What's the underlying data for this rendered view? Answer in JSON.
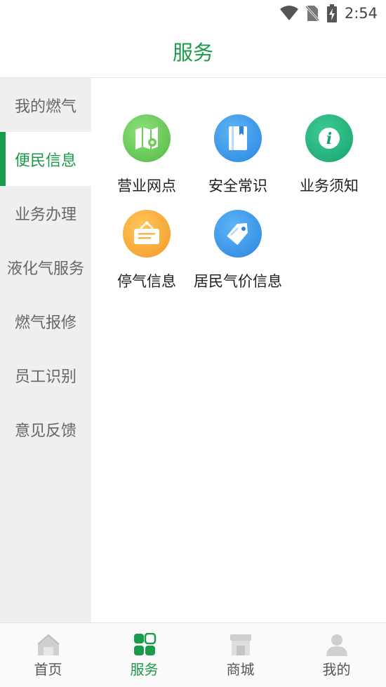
{
  "status_bar": {
    "time": "2:54"
  },
  "header": {
    "title": "服务"
  },
  "sidebar": {
    "items": [
      {
        "label": "我的燃气",
        "active": false
      },
      {
        "label": "便民信息",
        "active": true
      },
      {
        "label": "业务办理",
        "active": false
      },
      {
        "label": "液化气服务",
        "active": false
      },
      {
        "label": "燃气报修",
        "active": false
      },
      {
        "label": "员工识别",
        "active": false
      },
      {
        "label": "意见反馈",
        "active": false
      }
    ]
  },
  "services": [
    {
      "label": "营业网点",
      "icon": "map-icon",
      "color": "#5cc64e"
    },
    {
      "label": "安全常识",
      "icon": "book-icon",
      "color": "#2f8fe6"
    },
    {
      "label": "业务须知",
      "icon": "info-icon",
      "color": "#1fb07a"
    },
    {
      "label": "停气信息",
      "icon": "notice-board-icon",
      "color": "#f5a833"
    },
    {
      "label": "居民气价信息",
      "icon": "price-tag-icon",
      "color": "#2f8fe6"
    }
  ],
  "tabbar": {
    "items": [
      {
        "label": "首页",
        "icon": "home-icon",
        "active": false
      },
      {
        "label": "服务",
        "icon": "grid-icon",
        "active": true
      },
      {
        "label": "商城",
        "icon": "store-icon",
        "active": false
      },
      {
        "label": "我的",
        "icon": "person-icon",
        "active": false
      }
    ]
  },
  "colors": {
    "accent": "#1a9b49",
    "sidebar_bg": "#efefef"
  }
}
